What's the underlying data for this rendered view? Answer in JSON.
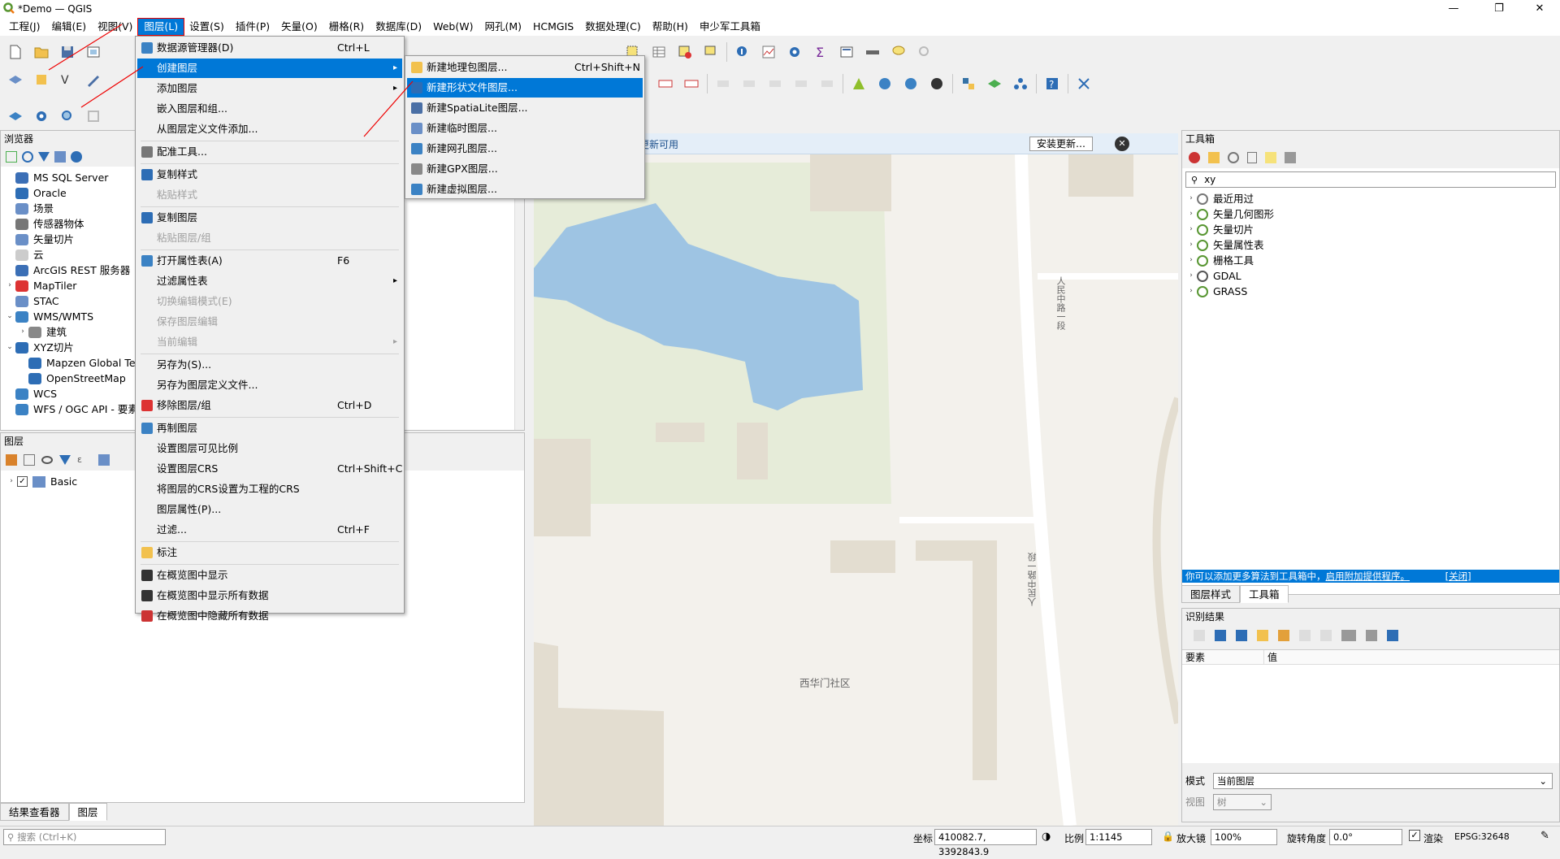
{
  "window": {
    "title": "*Demo — QGIS",
    "min": "—",
    "max": "❐",
    "close": "✕"
  },
  "menubar": [
    "工程(J)",
    "编辑(E)",
    "视图(V)",
    "图层(L)",
    "设置(S)",
    "插件(P)",
    "矢量(O)",
    "栅格(R)",
    "数据库(D)",
    "Web(W)",
    "网孔(M)",
    "HCMGIS",
    "数据处理(C)",
    "帮助(H)",
    "申少军工具箱"
  ],
  "layer_menu": {
    "items": [
      {
        "label": "数据源管理器(D)",
        "shortcut": "Ctrl+L"
      },
      {
        "label": "创建图层",
        "submenu": true,
        "highlight": true
      },
      {
        "label": "添加图层",
        "submenu": true
      },
      {
        "label": "嵌入图层和组..."
      },
      {
        "label": "从图层定义文件添加..."
      },
      {
        "label": "配准工具..."
      },
      {
        "label": "复制样式"
      },
      {
        "label": "粘贴样式",
        "disabled": true
      },
      {
        "label": "复制图层"
      },
      {
        "label": "粘贴图层/组",
        "disabled": true
      },
      {
        "label": "打开属性表(A)",
        "shortcut": "F6"
      },
      {
        "label": "过滤属性表",
        "submenu": true
      },
      {
        "label": "切换编辑模式(E)",
        "disabled": true
      },
      {
        "label": "保存图层编辑",
        "disabled": true
      },
      {
        "label": "当前编辑",
        "disabled": true,
        "submenu": true
      },
      {
        "label": "另存为(S)..."
      },
      {
        "label": "另存为图层定义文件..."
      },
      {
        "label": "移除图层/组",
        "shortcut": "Ctrl+D"
      },
      {
        "label": "再制图层"
      },
      {
        "label": "设置图层可见比例"
      },
      {
        "label": "设置图层CRS",
        "shortcut": "Ctrl+Shift+C"
      },
      {
        "label": "将图层的CRS设置为工程的CRS"
      },
      {
        "label": "图层属性(P)..."
      },
      {
        "label": "过滤...",
        "shortcut": "Ctrl+F"
      },
      {
        "label": "标注"
      },
      {
        "label": "在概览图中显示"
      },
      {
        "label": "在概览图中显示所有数据"
      },
      {
        "label": "在概览图中隐藏所有数据"
      }
    ]
  },
  "create_submenu": {
    "items": [
      {
        "label": "新建地理包图层...",
        "shortcut": "Ctrl+Shift+N"
      },
      {
        "label": "新建形状文件图层...",
        "highlight": true
      },
      {
        "label": "新建SpatiaLite图层..."
      },
      {
        "label": "新建临时图层..."
      },
      {
        "label": "新建网孔图层..."
      },
      {
        "label": "新建GPX图层..."
      },
      {
        "label": "新建虚拟图层..."
      }
    ]
  },
  "browser": {
    "title": "浏览器",
    "items": [
      {
        "label": "MS SQL Server",
        "exp": ""
      },
      {
        "label": "Oracle",
        "exp": ""
      },
      {
        "label": "场景",
        "exp": ""
      },
      {
        "label": "传感器物体",
        "exp": ""
      },
      {
        "label": "矢量切片",
        "exp": ""
      },
      {
        "label": "云",
        "exp": ""
      },
      {
        "label": "ArcGIS REST 服务器",
        "exp": ""
      },
      {
        "label": "MapTiler",
        "exp": "›"
      },
      {
        "label": "STAC",
        "exp": ""
      },
      {
        "label": "WMS/WMTS",
        "exp": "⌄"
      },
      {
        "label": "建筑",
        "exp": "›"
      },
      {
        "label": "XYZ切片",
        "exp": "⌄"
      },
      {
        "label": "Mapzen Global Te",
        "exp": ""
      },
      {
        "label": "OpenStreetMap",
        "exp": ""
      },
      {
        "label": "WCS",
        "exp": ""
      },
      {
        "label": "WFS / OGC API - 要素",
        "exp": ""
      }
    ]
  },
  "layers": {
    "title": "图层",
    "items": [
      {
        "label": "Basic"
      }
    ]
  },
  "bottom_tabs": [
    "结果查看器",
    "图层"
  ],
  "search": {
    "placeholder": "搜索 (Ctrl+K)"
  },
  "update_bar": {
    "text": "更新可用",
    "button": "安装更新…"
  },
  "map": {
    "labels": [
      "西华门社区",
      "人民中路一段",
      "人民中路一段"
    ]
  },
  "toolbox": {
    "title": "工具箱",
    "search": "xy",
    "items": [
      "最近用过",
      "矢量几何图形",
      "矢量切片",
      "矢量属性表",
      "栅格工具",
      "GDAL",
      "GRASS"
    ],
    "info": "你可以添加更多算法到工具箱中，",
    "info_link": "启用附加提供程序。",
    "info_close": "[关闭]",
    "tabs": [
      "图层样式",
      "工具箱"
    ]
  },
  "identify": {
    "title": "识别结果",
    "col_feature": "要素",
    "col_value": "值",
    "mode_label": "模式",
    "mode_value": "当前图层",
    "view_label": "视图",
    "view_value": "树"
  },
  "status": {
    "coord_label": "坐标",
    "coord_value": "410082.7, 3392843.9",
    "scale_label": "比例",
    "scale_value": "1:1145",
    "magnifier_label": "放大镜",
    "magnifier_value": "100%",
    "rotation_label": "旋转角度",
    "rotation_value": "0.0°",
    "render_label": "渲染",
    "crs": "EPSG:32648"
  },
  "colors": {
    "accent": "#0078d7",
    "water": "#9ec4e3",
    "park": "#e6ecd9",
    "building": "#e3ddd0"
  }
}
